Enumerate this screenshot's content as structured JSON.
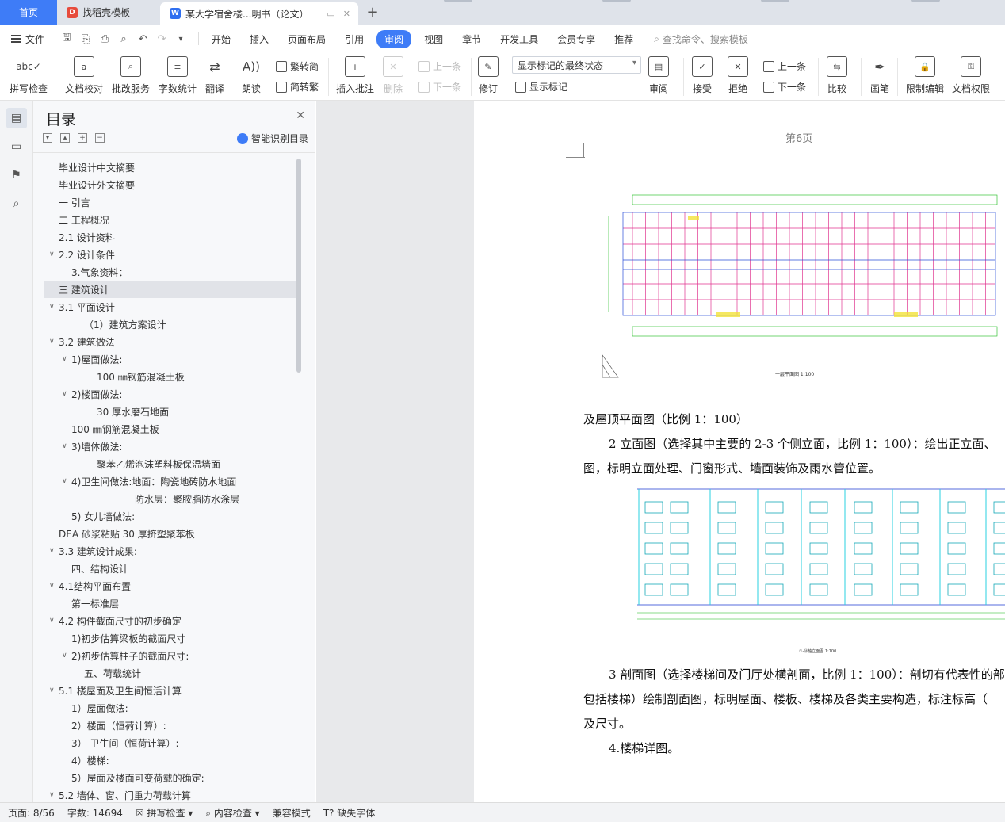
{
  "tabs": {
    "home": "首页",
    "template_tab": "找稻壳模板",
    "doc_tab": "某大学宿舍楼...明书（论文）"
  },
  "menu": {
    "file": "文件",
    "items": [
      "开始",
      "插入",
      "页面布局",
      "引用",
      "审阅",
      "视图",
      "章节",
      "开发工具",
      "会员专享",
      "推荐"
    ],
    "active": "审阅",
    "search_placeholder": "查找命令、搜索模板"
  },
  "ribbon": {
    "spell_check": "拼写检查",
    "doc_check": "文档校对",
    "batch_service": "批改服务",
    "word_count": "字数统计",
    "translate": "翻译",
    "read_aloud": "朗读",
    "trad": "繁转简",
    "simp": "简转繁",
    "insert_comment": "插入批注",
    "delete": "删除",
    "prev": "上一条",
    "next": "下一条",
    "revise": "修订",
    "display_state": "显示标记的最终状态",
    "show_marks": "显示标记",
    "review": "审阅",
    "accept": "接受",
    "reject": "拒绝",
    "prev2": "上一条",
    "next2": "下一条",
    "compare": "比较",
    "pen": "画笔",
    "restrict_edit": "限制编辑",
    "doc_permission": "文档权限"
  },
  "toc": {
    "title": "目录",
    "smart_label": "智能识别目录",
    "items": [
      {
        "text": "毕业设计中文摘要",
        "indent": 0,
        "arrow": false
      },
      {
        "text": "毕业设计外文摘要",
        "indent": 0,
        "arrow": false
      },
      {
        "text": "一   引言",
        "indent": 0,
        "arrow": false
      },
      {
        "text": "二  工程概况",
        "indent": 0,
        "arrow": false
      },
      {
        "text": "2.1  设计资料",
        "indent": 0,
        "arrow": false
      },
      {
        "text": "2.2 设计条件",
        "indent": 0,
        "arrow": true
      },
      {
        "text": "3.气象资料：",
        "indent": 1,
        "arrow": false
      },
      {
        "text": "三  建筑设计",
        "indent": 0,
        "arrow": false,
        "selected": true
      },
      {
        "text": "3.1  平面设计",
        "indent": 0,
        "arrow": true
      },
      {
        "text": "（1）建筑方案设计",
        "indent": 2,
        "arrow": false
      },
      {
        "text": "3.2 建筑做法",
        "indent": 0,
        "arrow": true
      },
      {
        "text": "1)屋面做法:",
        "indent": 1,
        "arrow": true
      },
      {
        "text": "100 ㎜钢筋混凝土板",
        "indent": 3,
        "arrow": false
      },
      {
        "text": "2)楼面做法:",
        "indent": 1,
        "arrow": true
      },
      {
        "text": "30 厚水磨石地面",
        "indent": 3,
        "arrow": false
      },
      {
        "text": "100 ㎜钢筋混凝土板",
        "indent": 1,
        "arrow": false
      },
      {
        "text": "3)墙体做法:",
        "indent": 1,
        "arrow": true
      },
      {
        "text": "聚苯乙烯泡沫塑料板保温墙面",
        "indent": 3,
        "arrow": false
      },
      {
        "text": "4)卫生间做法:地面：陶瓷地砖防水地面",
        "indent": 1,
        "arrow": true
      },
      {
        "text": "防水层：聚胺脂防水涂层",
        "indent": 6,
        "arrow": false
      },
      {
        "text": "5) 女儿墙做法:",
        "indent": 1,
        "arrow": false
      },
      {
        "text": "DEA 砂浆粘贴 30 厚挤塑聚苯板",
        "indent": 0,
        "arrow": false
      },
      {
        "text": "3.3  建筑设计成果:",
        "indent": 0,
        "arrow": true
      },
      {
        "text": "四、结构设计",
        "indent": 1,
        "arrow": false
      },
      {
        "text": "4.1结构平面布置",
        "indent": 0,
        "arrow": true
      },
      {
        "text": "第一标准层",
        "indent": 1,
        "arrow": false
      },
      {
        "text": "4.2 构件截面尺寸的初步确定",
        "indent": 0,
        "arrow": true
      },
      {
        "text": "1)初步估算梁板的截面尺寸",
        "indent": 1,
        "arrow": false
      },
      {
        "text": "2)初步估算柱子的截面尺寸:",
        "indent": 1,
        "arrow": true
      },
      {
        "text": "五、荷载统计",
        "indent": 2,
        "arrow": false
      },
      {
        "text": "5.1 楼屋面及卫生间恒活计算",
        "indent": 0,
        "arrow": true
      },
      {
        "text": "1）屋面做法:",
        "indent": 1,
        "arrow": false
      },
      {
        "text": "2）楼面（恒荷计算）:",
        "indent": 1,
        "arrow": false
      },
      {
        "text": "3）  卫生间（恒荷计算）:",
        "indent": 1,
        "arrow": false
      },
      {
        "text": "4）楼梯:",
        "indent": 1,
        "arrow": false
      },
      {
        "text": "5）屋面及楼面可变荷载的确定:",
        "indent": 1,
        "arrow": false
      },
      {
        "text": "5.2 墙体、窗、门重力荷载计算",
        "indent": 0,
        "arrow": true
      }
    ]
  },
  "document": {
    "page_label": "第6页",
    "drawing1_caption": "一层平面图 1:100",
    "line1": "及屋顶平面图（比例 1：100）",
    "line2": "2  立面图（选择其中主要的 2-3 个侧立面，比例 1：100）：绘出正立面、",
    "line3": "图，标明立面处理、门窗形式、墙面装饰及雨水管位置。",
    "drawing2_caption": "①-⑱轴立面图 1:100",
    "line4": "3  剖面图（选择楼梯间及门厅处横剖面，比例 1：100）：剖切有代表性的部",
    "line5": "包括楼梯）绘制剖面图，标明屋面、楼板、楼梯及各类主要构造，标注标高（",
    "line6": "及尺寸。",
    "line7": "4.楼梯详图。"
  },
  "status": {
    "page": "页面: 8/56",
    "words": "字数: 14694",
    "spell": "拼写检查",
    "content_check": "内容检查",
    "compat": "兼容模式",
    "missing_font": "缺失字体"
  }
}
